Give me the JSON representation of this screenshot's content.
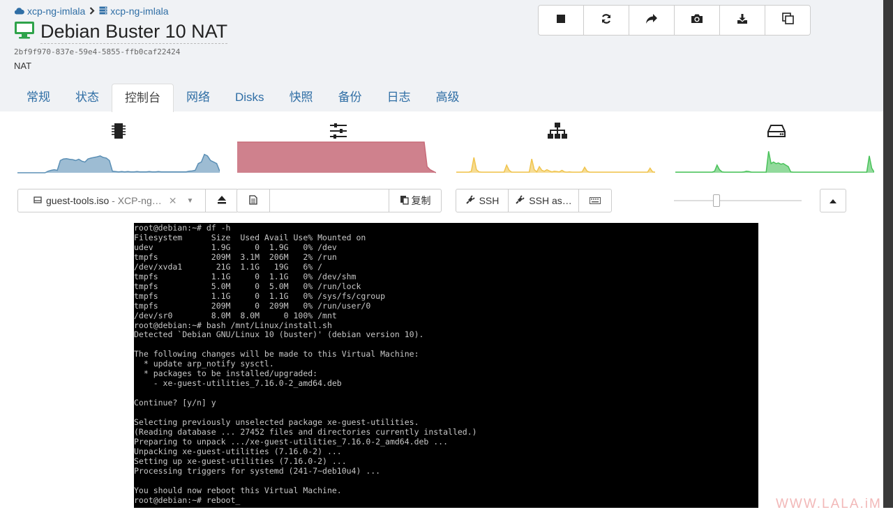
{
  "breadcrumb": {
    "pool": "xcp-ng-imlala",
    "host": "xcp-ng-imlala",
    "pool_icon": "cloud-icon",
    "host_icon": "server-icon",
    "separator_icon": "chevron-right-icon"
  },
  "vm": {
    "name": "Debian Buster 10 NAT",
    "uuid": "2bf9f970-837e-59e4-5855-ffb0caf22424",
    "description": "NAT",
    "icon": "desktop-icon",
    "icon_color": "#2ea34a"
  },
  "toolbar": [
    {
      "name": "stop",
      "icon": "stop-icon"
    },
    {
      "name": "reboot",
      "icon": "refresh-icon"
    },
    {
      "name": "migrate",
      "icon": "share-icon"
    },
    {
      "name": "snapshot",
      "icon": "camera-icon"
    },
    {
      "name": "export",
      "icon": "download-icon"
    },
    {
      "name": "copy",
      "icon": "clone-icon"
    }
  ],
  "tabs": [
    {
      "label": "常规",
      "active": false
    },
    {
      "label": "状态",
      "active": false
    },
    {
      "label": "控制台",
      "active": true
    },
    {
      "label": "网络",
      "active": false
    },
    {
      "label": "Disks",
      "active": false
    },
    {
      "label": "快照",
      "active": false
    },
    {
      "label": "备份",
      "active": false
    },
    {
      "label": "日志",
      "active": false
    },
    {
      "label": "高级",
      "active": false
    }
  ],
  "stats": {
    "cpu": {
      "icon": "cpu-icon",
      "color": "#5b8fb5",
      "values": [
        0,
        0,
        0,
        0,
        0,
        0,
        0,
        0,
        0,
        0,
        5,
        8,
        10,
        8,
        40,
        45,
        46,
        44,
        43,
        40,
        44,
        38,
        35,
        45,
        48,
        50,
        52,
        55,
        50,
        48,
        40,
        5,
        4,
        3,
        4,
        3,
        4,
        3,
        3,
        4,
        3,
        3,
        3,
        4,
        3,
        3,
        4,
        3,
        3,
        3,
        3,
        3,
        3,
        3,
        3,
        3,
        5,
        6,
        8,
        30,
        35,
        60,
        55,
        40,
        35,
        30,
        5
      ]
    },
    "memory": {
      "icon": "sliders-icon",
      "color": "#c76b79",
      "values": [
        100,
        100,
        100,
        100,
        100,
        100,
        100,
        100,
        100,
        100,
        100,
        100,
        100,
        100,
        100,
        100,
        100,
        100,
        100,
        100,
        100,
        100,
        100,
        100,
        100,
        100,
        100,
        100,
        100,
        100,
        100,
        100,
        100,
        100,
        100,
        100,
        100,
        100,
        100,
        100,
        100,
        100,
        100,
        100,
        100,
        100,
        100,
        100,
        100,
        100,
        100,
        100,
        100,
        100,
        100,
        100,
        100,
        100,
        100,
        100,
        100,
        100,
        100,
        100,
        20,
        10,
        5,
        0
      ]
    },
    "network": {
      "icon": "sitemap-icon",
      "color": "#f0c44d",
      "values": [
        2,
        2,
        2,
        2,
        2,
        2,
        5,
        50,
        10,
        3,
        2,
        2,
        2,
        2,
        2,
        2,
        2,
        2,
        2,
        2,
        25,
        8,
        2,
        2,
        2,
        2,
        2,
        2,
        2,
        2,
        45,
        10,
        3,
        20,
        8,
        5,
        10,
        6,
        3,
        5,
        4,
        3,
        8,
        3,
        2,
        3,
        2,
        2,
        2,
        2,
        3,
        18,
        5,
        2,
        2,
        2,
        2,
        2,
        2,
        2,
        2,
        2,
        2,
        2,
        2,
        2,
        2,
        2,
        2,
        2,
        2,
        2,
        2,
        2,
        2,
        2,
        2,
        15,
        3,
        2
      ]
    },
    "disk": {
      "icon": "hdd-icon",
      "color": "#49c25a",
      "values": [
        2,
        2,
        2,
        2,
        2,
        2,
        2,
        2,
        2,
        2,
        2,
        2,
        2,
        2,
        2,
        2,
        5,
        25,
        10,
        3,
        2,
        2,
        2,
        2,
        2,
        2,
        2,
        2,
        3,
        5,
        4,
        2,
        2,
        2,
        2,
        2,
        2,
        2,
        70,
        30,
        35,
        30,
        32,
        28,
        30,
        25,
        20,
        3,
        2,
        2,
        2,
        2,
        2,
        2,
        2,
        2,
        2,
        2,
        2,
        2,
        2,
        2,
        2,
        2,
        2,
        2,
        2,
        2,
        2,
        2,
        2,
        2,
        2,
        2,
        2,
        2,
        2,
        2,
        2,
        55,
        15,
        2
      ]
    }
  },
  "controls": {
    "iso_value": "guest-tools.iso",
    "iso_sr": " - XCP-ng…",
    "iso_icon": "disc-icon",
    "clear_icon": "times-icon",
    "caret_icon": "caret-down-icon",
    "eject_icon": "eject-icon",
    "clipboard_icon": "file-text-icon",
    "clipboard_value": "",
    "copy_label": "复制",
    "copy_icon": "paste-icon",
    "ssh_label": "SSH",
    "ssh_as_label": "SSH as…",
    "ssh_icon": "plug-icon",
    "keyboard_icon": "keyboard-icon",
    "scale_value": 0.33,
    "scroll_up_icon": "caret-up-icon"
  },
  "console": {
    "lines": [
      "root@debian:~# df -h",
      "Filesystem      Size  Used Avail Use% Mounted on",
      "udev            1.9G     0  1.9G   0% /dev",
      "tmpfs           209M  3.1M  206M   2% /run",
      "/dev/xvda1       21G  1.1G   19G   6% /",
      "tmpfs           1.1G     0  1.1G   0% /dev/shm",
      "tmpfs           5.0M     0  5.0M   0% /run/lock",
      "tmpfs           1.1G     0  1.1G   0% /sys/fs/cgroup",
      "tmpfs           209M     0  209M   0% /run/user/0",
      "/dev/sr0        8.0M  8.0M     0 100% /mnt",
      "root@debian:~# bash /mnt/Linux/install.sh",
      "Detected `Debian GNU/Linux 10 (buster)' (debian version 10).",
      "",
      "The following changes will be made to this Virtual Machine:",
      "  * update arp_notify sysctl.",
      "  * packages to be installed/upgraded:",
      "    - xe-guest-utilities_7.16.0-2_amd64.deb",
      "",
      "Continue? [y/n] y",
      "",
      "Selecting previously unselected package xe-guest-utilities.",
      "(Reading database ... 27452 files and directories currently installed.)",
      "Preparing to unpack .../xe-guest-utilities_7.16.0-2_amd64.deb ...",
      "Unpacking xe-guest-utilities (7.16.0-2) ...",
      "Setting up xe-guest-utilities (7.16.0-2) ...",
      "Processing triggers for systemd (241-7~deb10u4) ...",
      "",
      "You should now reboot this Virtual Machine.",
      "root@debian:~# reboot_"
    ]
  },
  "watermark": "WWW.LALA.iM"
}
